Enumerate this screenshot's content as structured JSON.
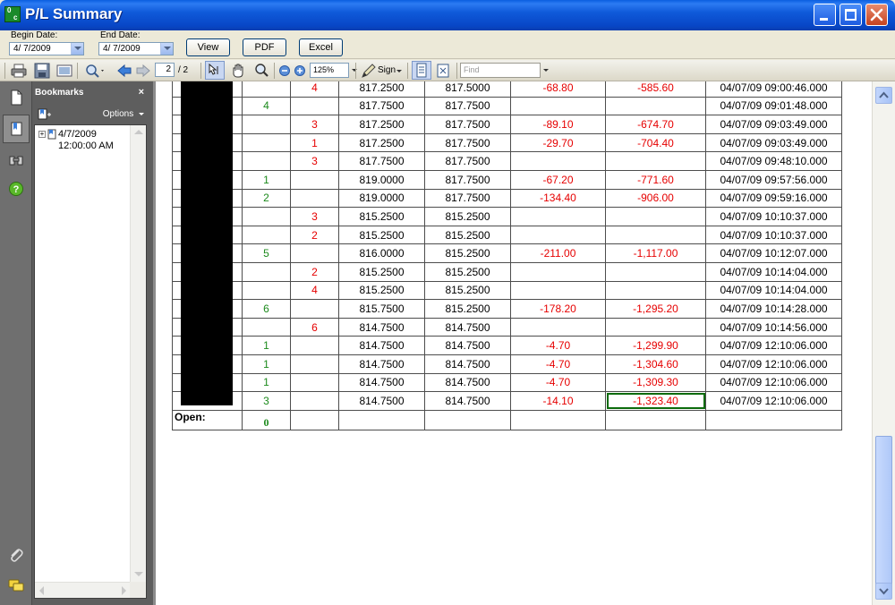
{
  "window": {
    "title": "P/L Summary",
    "icon_text_top": "0",
    "icon_text_bottom": "c"
  },
  "dates": {
    "begin_label": "Begin Date:",
    "begin_value": "4/ 7/2009",
    "end_label": "End Date:",
    "end_value": "4/ 7/2009"
  },
  "buttons": {
    "view": "View",
    "pdf": "PDF",
    "excel": "Excel"
  },
  "toolbar": {
    "page_current": "2",
    "page_total": "/ 2",
    "zoom": "125%",
    "sign_label": "Sign",
    "find_placeholder": "Find"
  },
  "bookmarks": {
    "title": "Bookmarks",
    "close": "×",
    "options": "Options",
    "item_date": "4/7/2009",
    "item_time": "12:00:00 AM"
  },
  "table": {
    "rows": [
      [
        "",
        "",
        "4",
        "817.2500",
        "817.5000",
        "-68.80",
        "-585.60",
        "04/07/09 09:00:46.000"
      ],
      [
        "",
        "4",
        "",
        "817.7500",
        "817.7500",
        "",
        "",
        "04/07/09 09:01:48.000"
      ],
      [
        "",
        "",
        "3",
        "817.2500",
        "817.7500",
        "-89.10",
        "-674.70",
        "04/07/09 09:03:49.000"
      ],
      [
        "",
        "",
        "1",
        "817.2500",
        "817.7500",
        "-29.70",
        "-704.40",
        "04/07/09 09:03:49.000"
      ],
      [
        "",
        "",
        "3",
        "817.7500",
        "817.7500",
        "",
        "",
        "04/07/09 09:48:10.000"
      ],
      [
        "",
        "1",
        "",
        "819.0000",
        "817.7500",
        "-67.20",
        "-771.60",
        "04/07/09 09:57:56.000"
      ],
      [
        "",
        "2",
        "",
        "819.0000",
        "817.7500",
        "-134.40",
        "-906.00",
        "04/07/09 09:59:16.000"
      ],
      [
        "",
        "",
        "3",
        "815.2500",
        "815.2500",
        "",
        "",
        "04/07/09 10:10:37.000"
      ],
      [
        "",
        "",
        "2",
        "815.2500",
        "815.2500",
        "",
        "",
        "04/07/09 10:10:37.000"
      ],
      [
        "",
        "5",
        "",
        "816.0000",
        "815.2500",
        "-211.00",
        "-1,117.00",
        "04/07/09 10:12:07.000"
      ],
      [
        "",
        "",
        "2",
        "815.2500",
        "815.2500",
        "",
        "",
        "04/07/09 10:14:04.000"
      ],
      [
        "",
        "",
        "4",
        "815.2500",
        "815.2500",
        "",
        "",
        "04/07/09 10:14:04.000"
      ],
      [
        "",
        "6",
        "",
        "815.7500",
        "815.2500",
        "-178.20",
        "-1,295.20",
        "04/07/09 10:14:28.000"
      ],
      [
        "",
        "",
        "6",
        "814.7500",
        "814.7500",
        "",
        "",
        "04/07/09 10:14:56.000"
      ],
      [
        "",
        "1",
        "",
        "814.7500",
        "814.7500",
        "-4.70",
        "-1,299.90",
        "04/07/09 12:10:06.000"
      ],
      [
        "",
        "1",
        "",
        "814.7500",
        "814.7500",
        "-4.70",
        "-1,304.60",
        "04/07/09 12:10:06.000"
      ],
      [
        "",
        "1",
        "",
        "814.7500",
        "814.7500",
        "-4.70",
        "-1,309.30",
        "04/07/09 12:10:06.000"
      ],
      [
        "",
        "3",
        "",
        "814.7500",
        "814.7500",
        "-14.10",
        "-1,323.40",
        "04/07/09 12:10:06.000"
      ]
    ],
    "open_label": "Open:",
    "open_value": "0",
    "highlight_row": 17,
    "highlight_col": 6
  },
  "colors": {
    "buy": "#1C8A1C",
    "sell": "#E60000",
    "highlight_border": "#0C6B0C",
    "titlebar": "#0846C6"
  },
  "icons": [
    "print-icon",
    "save-icon",
    "email-icon",
    "search-doc-icon",
    "prev-page-icon",
    "next-page-icon",
    "select-tool-icon",
    "hand-tool-icon",
    "zoom-tool-icon",
    "zoom-out-icon",
    "zoom-in-icon",
    "sign-pen-icon",
    "single-page-icon",
    "fit-page-icon",
    "pages-panel-icon",
    "bookmarks-panel-icon",
    "signatures-panel-icon",
    "help-icon",
    "attachments-icon",
    "comments-icon"
  ]
}
